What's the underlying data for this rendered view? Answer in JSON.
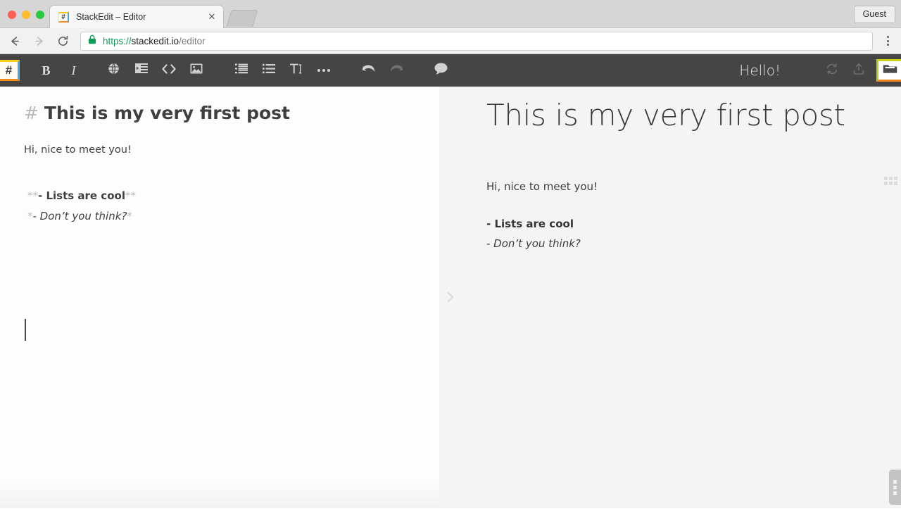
{
  "browser": {
    "tab": {
      "title": "StackEdit – Editor",
      "favicon_glyph": "#",
      "close_glyph": "✕"
    },
    "guest_label": "Guest",
    "url": {
      "scheme": "https://",
      "host": "stackedit.io",
      "path": "/editor"
    },
    "nav": {
      "back_glyph": "←",
      "forward_glyph": "→",
      "reload_glyph": "⟳"
    }
  },
  "app": {
    "logo_glyph": "#",
    "toolbar": [
      {
        "name": "bold-button",
        "label": "B",
        "kind": "text-bold"
      },
      {
        "name": "italic-button",
        "label": "I",
        "kind": "text-italic"
      },
      {
        "name": "link-button",
        "label": "",
        "kind": "icon"
      },
      {
        "name": "blockquote-button",
        "label": "",
        "kind": "icon"
      },
      {
        "name": "code-button",
        "label": "<>",
        "kind": "icon"
      },
      {
        "name": "image-button",
        "label": "",
        "kind": "icon"
      },
      {
        "name": "ordered-list-button",
        "label": "",
        "kind": "icon"
      },
      {
        "name": "unordered-list-button",
        "label": "",
        "kind": "icon"
      },
      {
        "name": "table-button",
        "label": "T",
        "kind": "icon"
      },
      {
        "name": "more-button",
        "label": "…",
        "kind": "dots"
      },
      {
        "name": "undo-button",
        "label": "",
        "kind": "icon"
      },
      {
        "name": "redo-button",
        "label": "",
        "kind": "icon"
      },
      {
        "name": "comment-button",
        "label": "",
        "kind": "icon"
      }
    ],
    "greeting": "Hello!",
    "sync_icon": "sync-icon",
    "publish_icon": "publish-icon",
    "folder_icon": "folder-icon"
  },
  "editor": {
    "heading_hash": "# ",
    "heading_text": "This is my very first post",
    "paragraph": "Hi, nice to meet you!",
    "list_bold_open": "**",
    "list_bold_text": "- Lists are cool",
    "list_bold_close": "**",
    "list_italic_open": "*",
    "list_italic_text": "- Don’t you think?",
    "list_italic_close": "*"
  },
  "preview": {
    "heading": "This is my very first post",
    "paragraph": "Hi, nice to meet you!",
    "list_bold": "- Lists are cool",
    "list_italic": "- Don’t you think?",
    "expand_chevron": "›"
  },
  "colors": {
    "toolbar_bg": "#454545",
    "editor_bg": "#fdfdfd",
    "preview_bg": "#f4f4f5",
    "accent_yellow": "#f7d117",
    "accent_orange": "#f28c17",
    "accent_blue": "#56a6e0",
    "accent_green": "#c8d219",
    "secure_green": "#0f9d58"
  }
}
